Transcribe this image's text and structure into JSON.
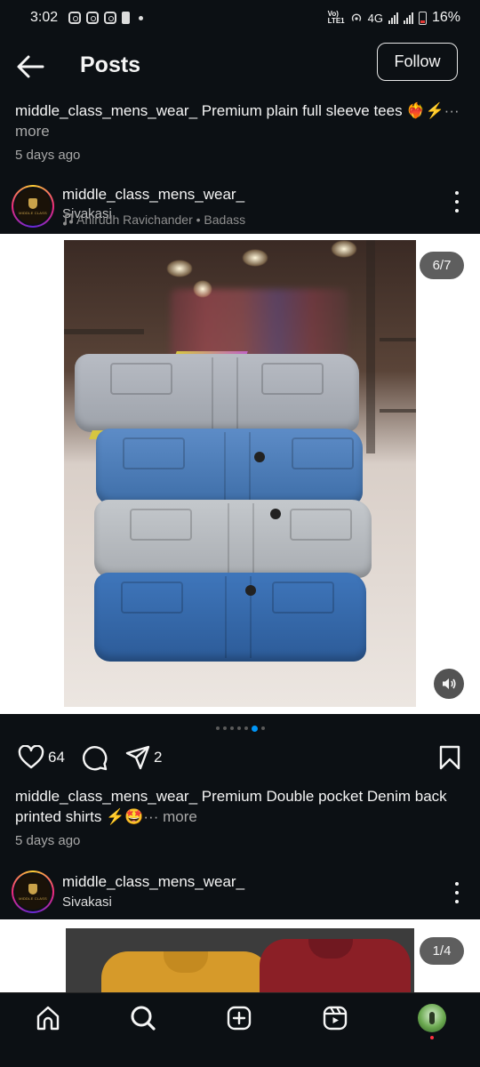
{
  "status_bar": {
    "time": "3:02",
    "network": "4G",
    "battery": "16%"
  },
  "header": {
    "title": "Posts",
    "follow_label": "Follow"
  },
  "prev_post": {
    "caption": "middle_class_mens_wear_ Premium plain  full sleeve tees ❤️‍🔥⚡",
    "more_label": "··· more",
    "time_ago": "5 days ago"
  },
  "post": {
    "username": "middle_class_mens_wear_",
    "location": "Sivakasi",
    "music": "Anirudh Ravichander • Badass",
    "avatar_logo_text": "MIDDLE CLASS",
    "media_counter": "6/7",
    "carousel_total": 7,
    "carousel_active": 6,
    "likes": "64",
    "shares": "2",
    "caption": "middle_class_mens_wear_ Premium Double pocket Denim back printed shirts ⚡🤩",
    "more_label": "··· more",
    "time_ago": "5 days ago"
  },
  "next_post": {
    "username": "middle_class_mens_wear_",
    "location": "Sivakasi",
    "media_counter": "1/4"
  },
  "icons": [
    "back-arrow-icon",
    "kebab-menu-icon",
    "music-note-icon",
    "volume-icon",
    "heart-icon",
    "comment-icon",
    "share-icon",
    "bookmark-icon",
    "home-icon",
    "search-icon",
    "create-icon",
    "reels-icon"
  ],
  "colors": {
    "background": "#0c1014",
    "accent_blue": "#0095f6",
    "secondary_text": "#a8a8a8"
  }
}
